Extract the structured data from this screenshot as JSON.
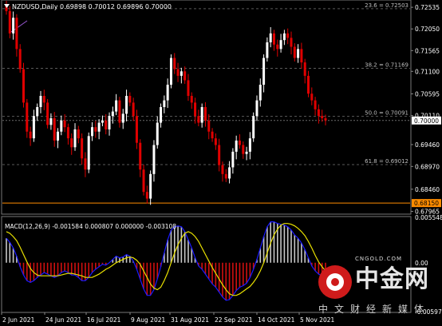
{
  "symbol_header": {
    "dropdown_icon": "triangle-down-icon",
    "text": "NZDUSD,Daily  0.69898 0.70012 0.69896 0.70000"
  },
  "price_axis": {
    "ticks": [
      "0.72535",
      "0.72050",
      "0.71565",
      "0.71100",
      "0.70595",
      "0.70110",
      "0.69460",
      "0.68970",
      "0.68460",
      "0.67965"
    ],
    "current_price": "0.70000",
    "low_level": "0.68150"
  },
  "fibonacci": [
    {
      "label": "23.6 = 0.72503",
      "value": 0.72503
    },
    {
      "label": "38.2 = 0.71169",
      "value": 0.71169
    },
    {
      "label": "50.0 = 0.70091",
      "value": 0.70091
    },
    {
      "label": "61.8 = 0.69012",
      "value": 0.69012
    }
  ],
  "macd": {
    "label": "MACD(12,26,9) -0.001584 0.000807 0.000000 -0.003108",
    "axis_ticks": [
      "0.005548",
      "0.00",
      "-0.005974"
    ]
  },
  "time_axis": [
    "2 Jun 2021",
    "24 Jun 2021",
    "16 Jul 2021",
    "9 Aug 2021",
    "31 Aug 2021",
    "22 Sep 2021",
    "14 Oct 2021",
    "5 Nov 2021"
  ],
  "watermark": {
    "url": "CNGOLD.COM",
    "title": "中金网",
    "subtitle": "中文财经新媒体"
  },
  "colors": {
    "background": "#000000",
    "bull_candle": "#ffffff",
    "bear_candle": "#e00000",
    "macd_histogram_positive": "#c8c8c8",
    "macd_histogram_negative": "#d01010",
    "macd_main_line": "#1a1aff",
    "macd_signal_line": "#e8e000",
    "low_line": "#ff8c00",
    "grid_lines": "#5a5a5a"
  },
  "chart_data": {
    "type": "candlestick",
    "title": "NZDUSD,Daily",
    "ohlc_last": {
      "open": 0.69898,
      "high": 0.70012,
      "low": 0.69896,
      "close": 0.7
    },
    "close_series": [
      0.7245,
      0.7195,
      0.723,
      0.716,
      0.7115,
      0.704,
      0.6975,
      0.696,
      0.701,
      0.703,
      0.7055,
      0.704,
      0.699,
      0.7005,
      0.6955,
      0.6975,
      0.7,
      0.6985,
      0.696,
      0.694,
      0.698,
      0.696,
      0.6915,
      0.689,
      0.6965,
      0.6985,
      0.6975,
      0.6995,
      0.7,
      0.698,
      0.701,
      0.702,
      0.7045,
      0.6995,
      0.7015,
      0.7055,
      0.704,
      0.701,
      0.695,
      0.689,
      0.684,
      0.6825,
      0.688,
      0.6945,
      0.6995,
      0.703,
      0.7045,
      0.708,
      0.714,
      0.7115,
      0.71,
      0.711,
      0.709,
      0.7055,
      0.704,
      0.701,
      0.6995,
      0.703,
      0.7,
      0.6975,
      0.696,
      0.6945,
      0.69,
      0.688,
      0.687,
      0.6895,
      0.693,
      0.6955,
      0.6945,
      0.6925,
      0.693,
      0.696,
      0.701,
      0.7045,
      0.708,
      0.714,
      0.7175,
      0.7195,
      0.717,
      0.716,
      0.718,
      0.7195,
      0.7185,
      0.7165,
      0.714,
      0.716,
      0.713,
      0.71,
      0.706,
      0.7045,
      0.7025,
      0.701,
      0.7005,
      0.7
    ],
    "macd_main": [
      0.003,
      0.0025,
      0.0018,
      0.0008,
      -0.0005,
      -0.0015,
      -0.0022,
      -0.0024,
      -0.0022,
      -0.0018,
      -0.0015,
      -0.0012,
      -0.0014,
      -0.0016,
      -0.0018,
      -0.0016,
      -0.0012,
      -0.001,
      -0.0012,
      -0.0015,
      -0.0015,
      -0.0018,
      -0.0022,
      -0.0022,
      -0.0018,
      -0.0012,
      -0.0008,
      -0.0005,
      -0.0002,
      -0.0003,
      0.0,
      0.0004,
      0.0008,
      0.0006,
      0.0007,
      0.001,
      0.0008,
      0.0002,
      -0.0008,
      -0.002,
      -0.0032,
      -0.004,
      -0.004,
      -0.0033,
      -0.002,
      -0.0005,
      0.0012,
      0.0028,
      0.004,
      0.0044,
      0.0045,
      0.0044,
      0.0038,
      0.0028,
      0.0018,
      0.0006,
      -0.0004,
      -0.0008,
      -0.0014,
      -0.002,
      -0.0026,
      -0.003,
      -0.0036,
      -0.0042,
      -0.0046,
      -0.0045,
      -0.004,
      -0.0034,
      -0.003,
      -0.0028,
      -0.0025,
      -0.0018,
      -0.0008,
      0.0004,
      0.0018,
      0.0032,
      0.0044,
      0.005,
      0.005,
      0.0048,
      0.0047,
      0.0046,
      0.0044,
      0.004,
      0.0034,
      0.003,
      0.0024,
      0.0016,
      0.0006,
      -0.0004,
      -0.001,
      -0.0014,
      -0.0016,
      -0.0016
    ],
    "macd_signal": [
      0.0038,
      0.0036,
      0.0032,
      0.0027,
      0.0019,
      0.001,
      0.0001,
      -0.0007,
      -0.0012,
      -0.0015,
      -0.0016,
      -0.0016,
      -0.0016,
      -0.0016,
      -0.0016,
      -0.0016,
      -0.0015,
      -0.0014,
      -0.0013,
      -0.0013,
      -0.0014,
      -0.0015,
      -0.0016,
      -0.0018,
      -0.0018,
      -0.0018,
      -0.0016,
      -0.0014,
      -0.0011,
      -0.0008,
      -0.0006,
      -0.0003,
      0.0,
      0.0002,
      0.0004,
      0.0006,
      0.0007,
      0.0006,
      0.0003,
      -0.0002,
      -0.001,
      -0.0018,
      -0.0026,
      -0.0031,
      -0.0033,
      -0.003,
      -0.0022,
      -0.0012,
      0.0,
      0.0012,
      0.0022,
      0.003,
      0.0036,
      0.0038,
      0.0036,
      0.0032,
      0.0026,
      0.0018,
      0.001,
      0.0002,
      -0.0006,
      -0.0013,
      -0.002,
      -0.0027,
      -0.0033,
      -0.0038,
      -0.004,
      -0.004,
      -0.0038,
      -0.0035,
      -0.0032,
      -0.0029,
      -0.0024,
      -0.0018,
      -0.001,
      0.0,
      0.0012,
      0.0024,
      0.0034,
      0.0041,
      0.0046,
      0.0048,
      0.0048,
      0.0047,
      0.0045,
      0.0042,
      0.0038,
      0.0033,
      0.0026,
      0.0018,
      0.0009,
      0.0001,
      -0.0005,
      -0.001
    ],
    "ylim_price": [
      0.6792,
      0.7268
    ],
    "ylim_macd": [
      -0.00598,
      0.00555
    ]
  }
}
